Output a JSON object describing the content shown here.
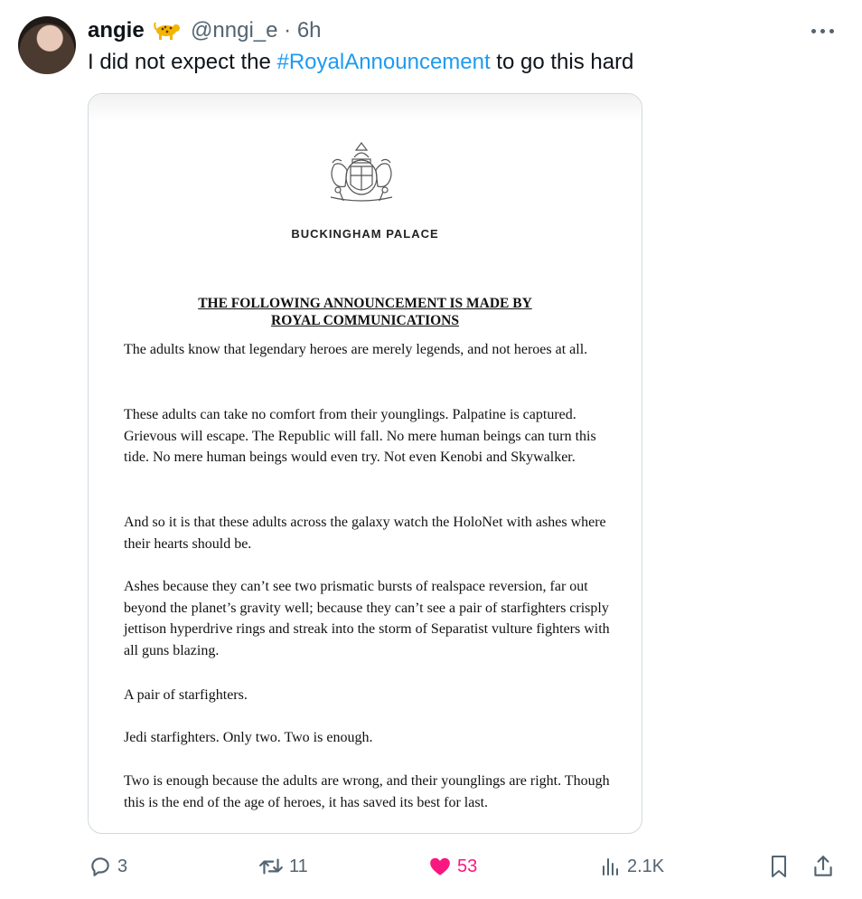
{
  "tweet": {
    "display_name": "angie",
    "handle": "@nngi_e",
    "separator": "·",
    "time": "6h",
    "text_before": "I did not expect the ",
    "hashtag": "#RoyalAnnouncement",
    "text_after": " to go this hard"
  },
  "announcement": {
    "palace": "BUCKINGHAM PALACE",
    "heading_line1": "THE FOLLOWING ANNOUNCEMENT IS MADE BY",
    "heading_line2": "ROYAL COMMUNICATIONS",
    "paragraphs": [
      "The adults know that legendary heroes are merely legends, and not heroes at all.",
      "These adults can take no comfort from their younglings. Palpatine is captured. Grievous will escape. The Republic will fall. No mere human beings can turn this tide. No mere human beings would even try. Not even Kenobi and Skywalker.",
      "And so it is that these adults across the galaxy watch the HoloNet with ashes where their hearts should be.",
      "Ashes because they can’t see two prismatic bursts of realspace reversion, far out beyond the planet’s gravity well; because they can’t see a pair of starfighters crisply jettison hyperdrive rings and streak into the storm of Separatist vulture fighters with all guns blazing.",
      "A pair of starfighters.",
      "Jedi starfighters. Only two. Two is enough.",
      "Two is enough because the adults are wrong, and their younglings are right. Though this is the end of the age of heroes, it has saved its best for last."
    ]
  },
  "actions": {
    "replies": "3",
    "reposts": "11",
    "likes": "53",
    "views": "2.1K"
  },
  "colors": {
    "accent": "#1d9bf0",
    "like": "#f91880",
    "muted": "#536471"
  },
  "icons": [
    "leopard-emoji-icon",
    "more-options-icon",
    "royal-crest-icon",
    "reply-icon",
    "repost-icon",
    "heart-icon",
    "views-icon",
    "bookmark-icon",
    "share-icon"
  ]
}
